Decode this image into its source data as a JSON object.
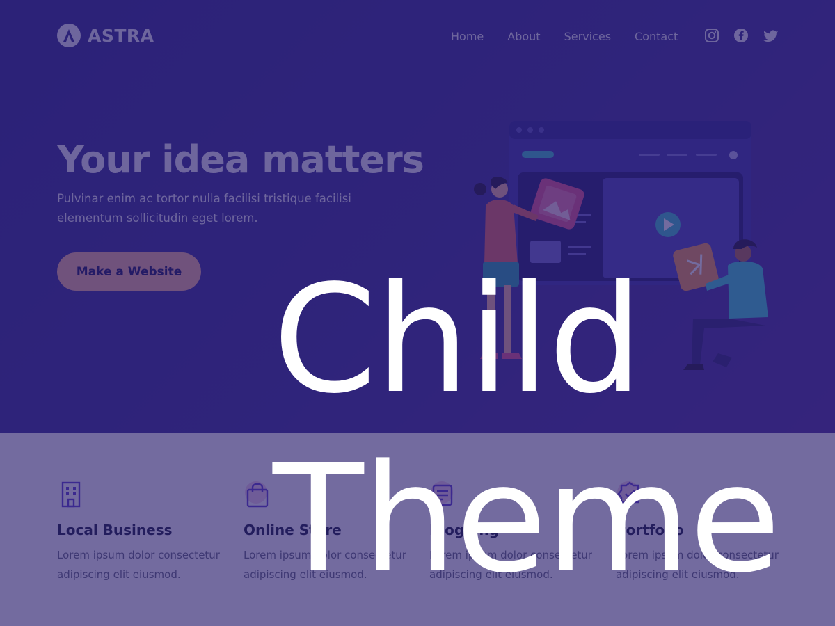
{
  "brand": {
    "name": "ASTRA"
  },
  "nav": {
    "links": [
      "Home",
      "About",
      "Services",
      "Contact"
    ],
    "social_icons": [
      "instagram-icon",
      "facebook-icon",
      "twitter-icon"
    ]
  },
  "hero": {
    "title": "Your idea matters",
    "description": "Pulvinar enim ac tortor nulla facilisi tristique facilisi elementum sollicitudin eget lorem.",
    "cta_label": "Make a Website"
  },
  "features": [
    {
      "icon": "building-icon",
      "title": "Local Business",
      "text": "Lorem ipsum dolor consectetur adipiscing elit eiusmod."
    },
    {
      "icon": "shopping-bag-icon",
      "title": "Online Store",
      "text": "Lorem ipsum dolor consectetur adipiscing elit eiusmod."
    },
    {
      "icon": "blog-icon",
      "title": "Blogging",
      "text": "Lorem ipsum dolor consectetur adipiscing elit eiusmod."
    },
    {
      "icon": "badge-icon",
      "title": "Portfolio",
      "text": "Lorem ipsum dolor consectetur adipiscing elit eiusmod."
    }
  ],
  "overlay": {
    "line1": "Child",
    "line2": "Theme"
  },
  "colors": {
    "hero_bg": "#2f2a8d",
    "cta_bg": "#f7b79a",
    "overlay_tint": "#2a1e6e",
    "overlay_text": "#ffffff"
  }
}
